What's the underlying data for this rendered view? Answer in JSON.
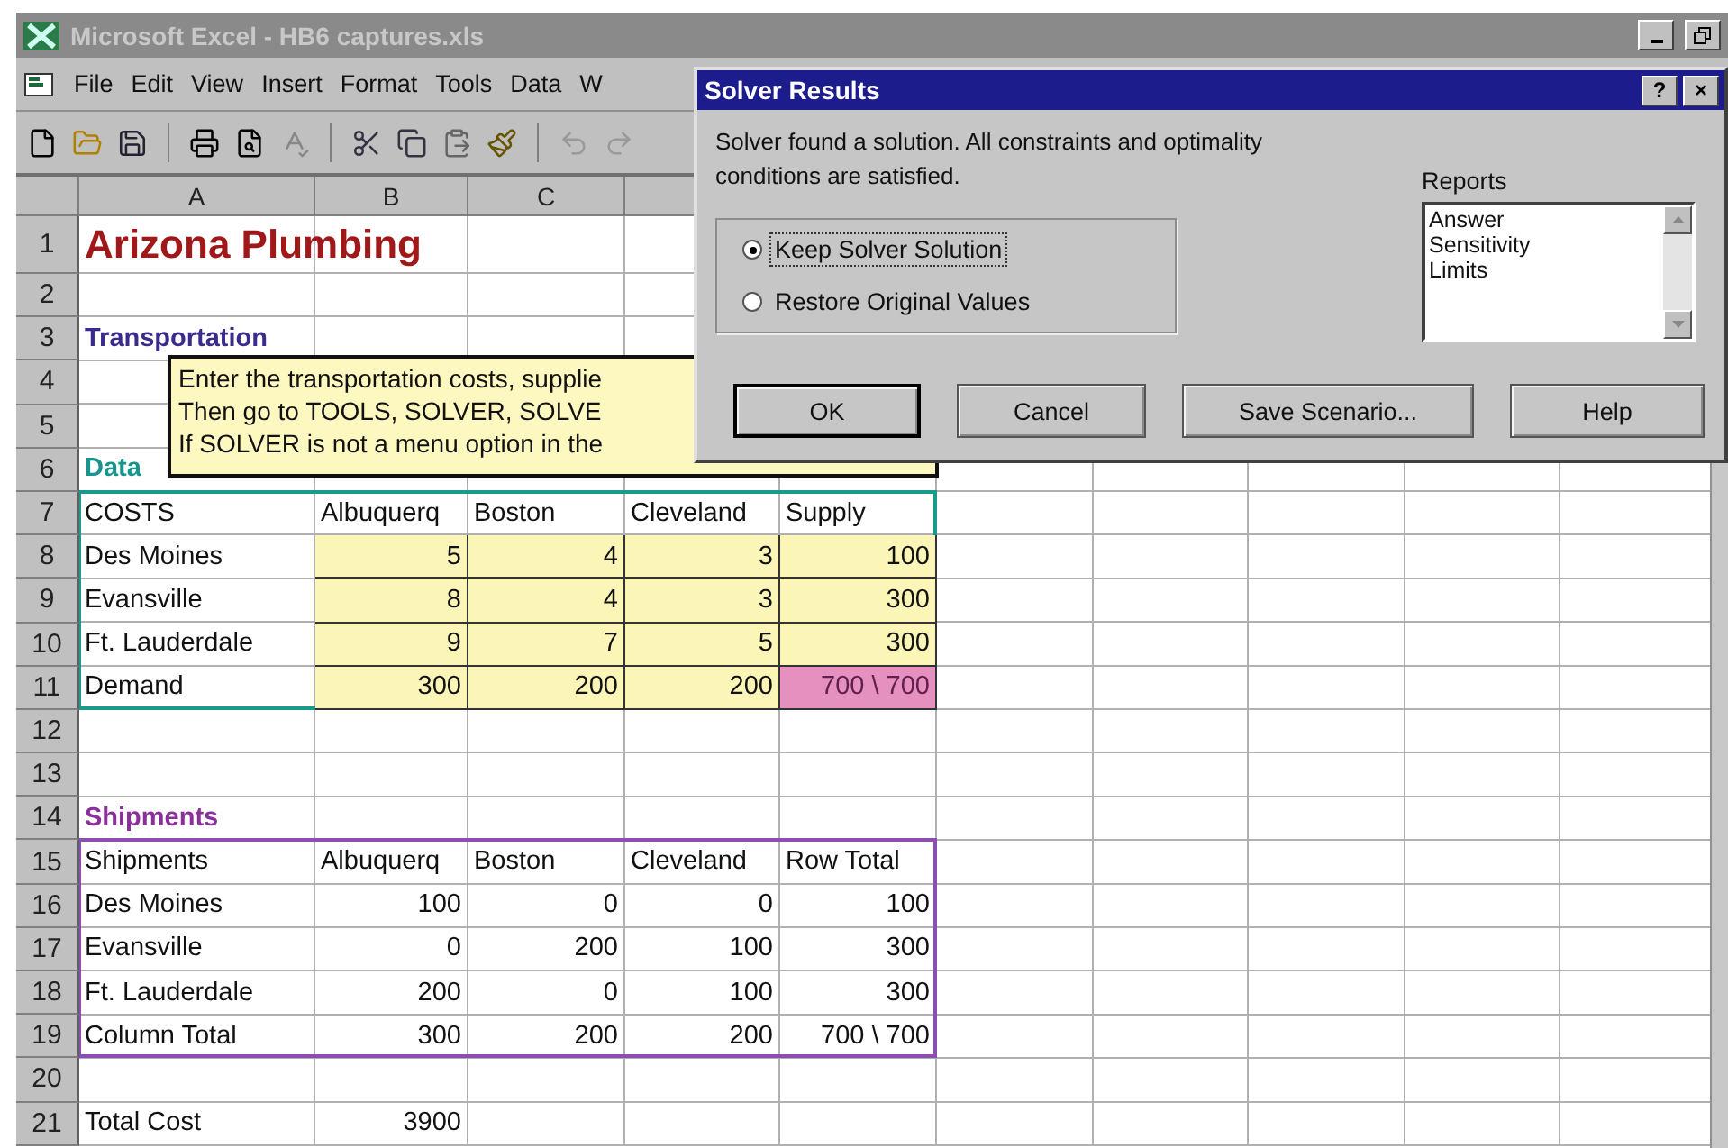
{
  "window": {
    "title": "Microsoft Excel - HB6 captures.xls"
  },
  "menu": [
    "File",
    "Edit",
    "View",
    "Insert",
    "Format",
    "Tools",
    "Data",
    "W"
  ],
  "columns": [
    "A",
    "B",
    "C"
  ],
  "blocks": [
    {
      "kind": "plain",
      "rows": [
        {
          "number": "1",
          "cells": [
            {
              "kind": "title",
              "text": "Arizona Plumbing"
            }
          ]
        },
        {
          "number": "2"
        },
        {
          "number": "3",
          "cells": [
            {
              "kind": "section",
              "text": "Transportation",
              "color": "#3a2c8c"
            }
          ]
        },
        {
          "number": "4"
        },
        {
          "number": "5"
        },
        {
          "number": "6",
          "cells": [
            {
              "kind": "section",
              "text": "Data",
              "color": "#17958c"
            }
          ]
        }
      ]
    },
    {
      "kind": "framed",
      "color": "#1a9a8a",
      "rows": [
        {
          "number": "7",
          "cells": [
            {
              "kind": "text",
              "text": "COSTS"
            },
            {
              "kind": "text",
              "text": "Albuquerq"
            },
            {
              "kind": "text",
              "text": "Boston"
            },
            {
              "kind": "text",
              "text": "Cleveland"
            },
            {
              "kind": "text",
              "text": "Supply"
            }
          ]
        },
        {
          "number": "8",
          "cells": [
            {
              "kind": "text",
              "text": "Des Moines"
            },
            {
              "kind": "input",
              "text": "5"
            },
            {
              "kind": "input",
              "text": "4"
            },
            {
              "kind": "input",
              "text": "3"
            },
            {
              "kind": "input",
              "text": "100"
            }
          ]
        },
        {
          "number": "9",
          "cells": [
            {
              "kind": "text",
              "text": "Evansville"
            },
            {
              "kind": "input",
              "text": "8"
            },
            {
              "kind": "input",
              "text": "4"
            },
            {
              "kind": "input",
              "text": "3"
            },
            {
              "kind": "input",
              "text": "300"
            }
          ]
        },
        {
          "number": "10",
          "cells": [
            {
              "kind": "text",
              "text": "Ft. Lauderdale"
            },
            {
              "kind": "input",
              "text": "9"
            },
            {
              "kind": "input",
              "text": "7"
            },
            {
              "kind": "input",
              "text": "5"
            },
            {
              "kind": "input",
              "text": "300"
            }
          ]
        },
        {
          "number": "11",
          "cells": [
            {
              "kind": "text",
              "text": "Demand"
            },
            {
              "kind": "input",
              "text": "300"
            },
            {
              "kind": "input",
              "text": "200"
            },
            {
              "kind": "input",
              "text": "200"
            },
            {
              "kind": "check",
              "text": "700 \\ 700"
            }
          ]
        }
      ]
    },
    {
      "kind": "plain",
      "rows": [
        {
          "number": "12"
        },
        {
          "number": "13"
        },
        {
          "number": "14",
          "cells": [
            {
              "kind": "section",
              "text": "Shipments",
              "color": "#8a2f9c"
            }
          ]
        }
      ]
    },
    {
      "kind": "framed",
      "color": "#8a4fb0",
      "rows": [
        {
          "number": "15",
          "cells": [
            {
              "kind": "text",
              "text": "Shipments"
            },
            {
              "kind": "text",
              "text": "Albuquerq"
            },
            {
              "kind": "text",
              "text": "Boston"
            },
            {
              "kind": "text",
              "text": "Cleveland"
            },
            {
              "kind": "text",
              "text": "Row Total"
            }
          ]
        },
        {
          "number": "16",
          "cells": [
            {
              "kind": "text",
              "text": "Des Moines"
            },
            {
              "kind": "number",
              "text": "100"
            },
            {
              "kind": "number",
              "text": "0"
            },
            {
              "kind": "number",
              "text": "0"
            },
            {
              "kind": "number",
              "text": "100"
            }
          ]
        },
        {
          "number": "17",
          "cells": [
            {
              "kind": "text",
              "text": "Evansville"
            },
            {
              "kind": "number",
              "text": "0"
            },
            {
              "kind": "number",
              "text": "200"
            },
            {
              "kind": "number",
              "text": "100"
            },
            {
              "kind": "number",
              "text": "300"
            }
          ]
        },
        {
          "number": "18",
          "cells": [
            {
              "kind": "text",
              "text": "Ft. Lauderdale"
            },
            {
              "kind": "number",
              "text": "200"
            },
            {
              "kind": "number",
              "text": "0"
            },
            {
              "kind": "number",
              "text": "100"
            },
            {
              "kind": "number",
              "text": "300"
            }
          ]
        },
        {
          "number": "19",
          "cells": [
            {
              "kind": "text",
              "text": "Column Total"
            },
            {
              "kind": "number",
              "text": "300"
            },
            {
              "kind": "number",
              "text": "200"
            },
            {
              "kind": "number",
              "text": "200"
            },
            {
              "kind": "number",
              "text": "700 \\ 700"
            }
          ]
        }
      ]
    },
    {
      "kind": "plain",
      "rows": [
        {
          "number": "20"
        },
        {
          "number": "21",
          "cells": [
            {
              "kind": "text",
              "text": "Total Cost"
            },
            {
              "kind": "number",
              "text": "3900"
            }
          ]
        }
      ]
    }
  ],
  "comment": {
    "lines": [
      "Enter the transportation costs, supplie",
      "Then go to TOOLS, SOLVER, SOLVE",
      "If SOLVER is not a menu option in the"
    ]
  },
  "dialog": {
    "title": "Solver Results",
    "title_buttons": [
      "?",
      "×"
    ],
    "message": "Solver found a solution.  All constraints and optimality conditions are satisfied.",
    "options": [
      {
        "label": "Keep Solver Solution",
        "selected": true
      },
      {
        "label": "Restore Original Values",
        "selected": false
      }
    ],
    "reports": {
      "label": "Reports",
      "items": [
        "Answer",
        "Sensitivity",
        "Limits"
      ]
    },
    "buttons": [
      "OK",
      "Cancel",
      "Save Scenario...",
      "Help"
    ]
  }
}
